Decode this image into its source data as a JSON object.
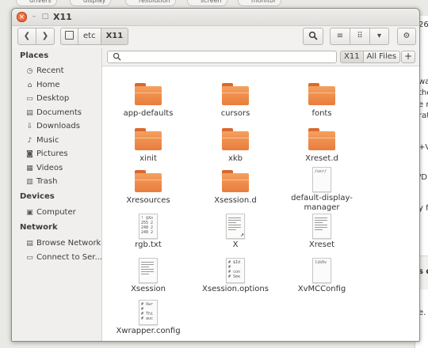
{
  "background": {
    "tabs": [
      "drivers",
      "display",
      "resolution",
      "screen",
      "monitor"
    ],
    "fragments": [
      "26",
      "war",
      "the",
      "e n",
      "rati",
      "+V",
      "/D",
      "y f",
      "s d",
      "e."
    ]
  },
  "window": {
    "title": "X11",
    "close_glyph": "×",
    "min_glyph": "–",
    "max_glyph": "□"
  },
  "toolbar": {
    "back_glyph": "❮",
    "forward_glyph": "❯",
    "breadcrumbs": [
      "etc",
      "X11"
    ],
    "search_glyph": "🔍",
    "list_glyph": "≡",
    "grid_glyph": "⠿",
    "dropdown_glyph": "▾",
    "menu_glyph": "⚙"
  },
  "sidebar": {
    "places_heading": "Places",
    "places": [
      {
        "label": "Recent",
        "icon": "clock-icon",
        "glyph": "◷"
      },
      {
        "label": "Home",
        "icon": "home-icon",
        "glyph": "⌂"
      },
      {
        "label": "Desktop",
        "icon": "desktop-icon",
        "glyph": "▭"
      },
      {
        "label": "Documents",
        "icon": "documents-icon",
        "glyph": "▤"
      },
      {
        "label": "Downloads",
        "icon": "downloads-icon",
        "glyph": "⇩"
      },
      {
        "label": "Music",
        "icon": "music-icon",
        "glyph": "♪"
      },
      {
        "label": "Pictures",
        "icon": "pictures-icon",
        "glyph": "◙"
      },
      {
        "label": "Videos",
        "icon": "videos-icon",
        "glyph": "▦"
      },
      {
        "label": "Trash",
        "icon": "trash-icon",
        "glyph": "▥"
      }
    ],
    "devices_heading": "Devices",
    "devices": [
      {
        "label": "Computer",
        "icon": "computer-icon",
        "glyph": "▣"
      }
    ],
    "network_heading": "Network",
    "network": [
      {
        "label": "Browse Network",
        "icon": "network-icon",
        "glyph": "▤"
      },
      {
        "label": "Connect to Ser...",
        "icon": "server-icon",
        "glyph": "▭"
      }
    ]
  },
  "search": {
    "placeholder": "",
    "icon_glyph": "🔍",
    "location_current": "X11",
    "location_all": "All Files",
    "add_glyph": "+"
  },
  "files": [
    {
      "name": "app-defaults",
      "kind": "folder"
    },
    {
      "name": "cursors",
      "kind": "folder"
    },
    {
      "name": "fonts",
      "kind": "folder"
    },
    {
      "name": "xinit",
      "kind": "folder"
    },
    {
      "name": "xkb",
      "kind": "folder"
    },
    {
      "name": "Xreset.d",
      "kind": "folder"
    },
    {
      "name": "Xresources",
      "kind": "folder"
    },
    {
      "name": "Xsession.d",
      "kind": "folder"
    },
    {
      "name": "default-display-manager",
      "kind": "text",
      "preview": [
        "/usr/"
      ]
    },
    {
      "name": "rgb.txt",
      "kind": "text",
      "preview": [
        "! $Xo",
        "255 2",
        "248 2",
        "248 2"
      ]
    },
    {
      "name": "X",
      "kind": "text",
      "preview": [],
      "badge": "↗"
    },
    {
      "name": "Xreset",
      "kind": "text",
      "preview": []
    },
    {
      "name": "Xsession",
      "kind": "text",
      "preview": []
    },
    {
      "name": "Xsession.options",
      "kind": "text",
      "preview": [
        "# $Id",
        "#",
        "# con",
        "# See"
      ]
    },
    {
      "name": "XvMCConfig",
      "kind": "text",
      "preview": [
        "libXv"
      ]
    },
    {
      "name": "Xwrapper.config",
      "kind": "text",
      "preview": [
        "# Xwr",
        "#",
        "# Thi",
        "# auc"
      ]
    }
  ],
  "colors": {
    "folder_orange": "#e97d3c",
    "close_button": "#e8632c"
  }
}
